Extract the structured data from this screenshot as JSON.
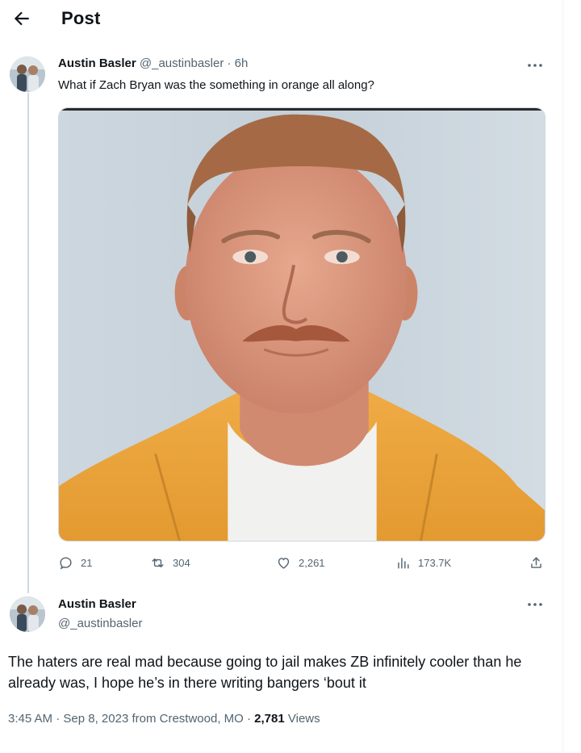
{
  "header": {
    "title": "Post",
    "back_icon": "arrow-left-icon"
  },
  "tweet": {
    "author_name": "Austin Basler",
    "handle": "@_austinbasler",
    "separator": "·",
    "time": "6h",
    "text": "What if Zach Bryan was the something in orange all along?",
    "media_description_icon": "photo-mugshot",
    "stats": {
      "replies": "21",
      "reposts": "304",
      "likes": "2,261",
      "views": "173.7K"
    },
    "icons": [
      "reply-icon",
      "repost-icon",
      "like-icon",
      "views-icon",
      "share-icon",
      "more-icon"
    ]
  },
  "reply": {
    "author_name": "Austin Basler",
    "handle": "@_austinbasler",
    "text": "The haters are real mad because going to jail makes ZB infinitely cooler than he already was, I hope he’s in there writing bangers ‘bout it",
    "meta": {
      "time": "3:45 AM",
      "sep1": " · ",
      "date": "Sep 8, 2023",
      "location": " from Crestwood, MO",
      "sep2": " · ",
      "views_count": "2,781",
      "views_label": " Views"
    }
  },
  "colors": {
    "text_primary": "#0f1419",
    "text_secondary": "#536471",
    "border": "#cfd9de",
    "jumpsuit": "#e8a23a",
    "backdrop": "#c9d4dc"
  }
}
